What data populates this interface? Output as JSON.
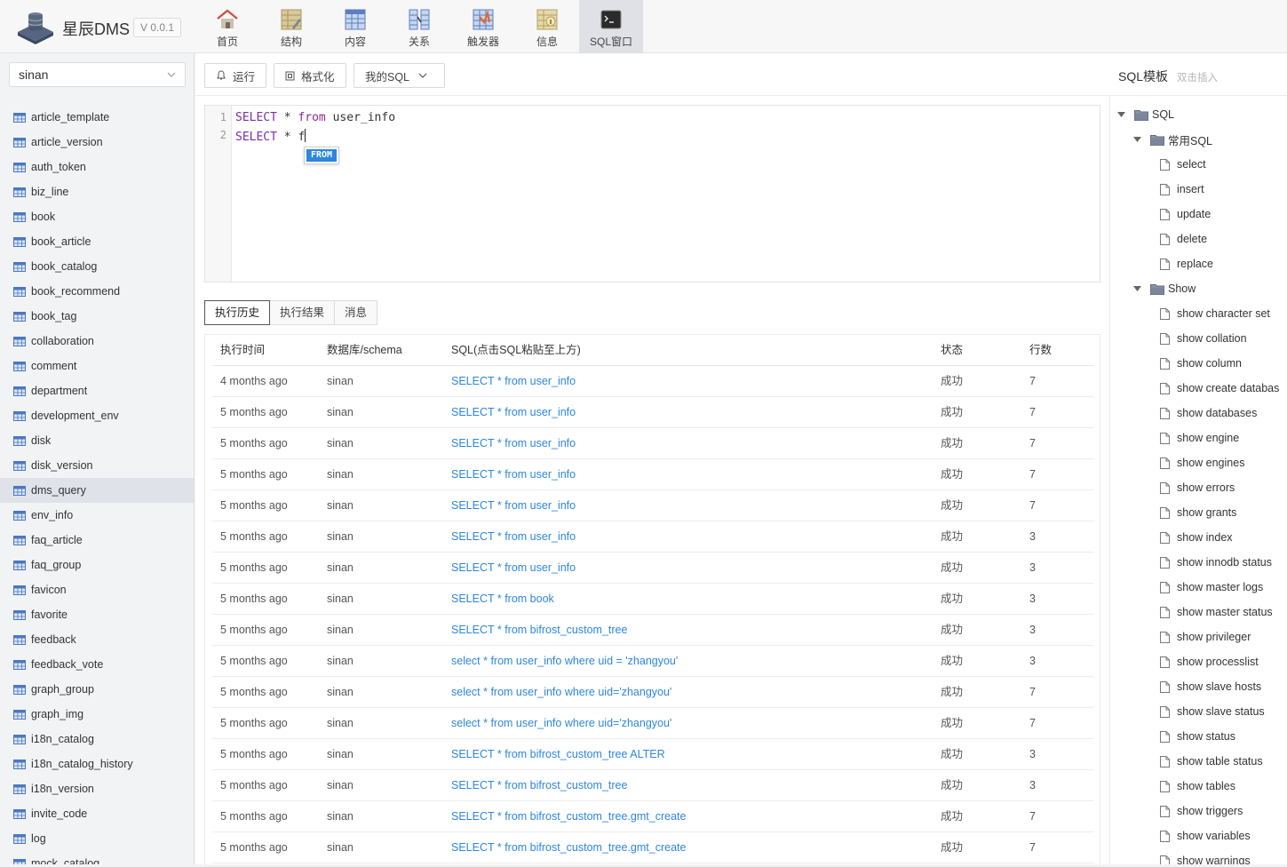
{
  "app": {
    "name": "星辰DMS",
    "version": "V 0.0.1"
  },
  "nav": [
    {
      "label": "首页",
      "icon": "home-icon"
    },
    {
      "label": "结构",
      "icon": "structure-icon"
    },
    {
      "label": "内容",
      "icon": "content-table-icon"
    },
    {
      "label": "关系",
      "icon": "relation-icon"
    },
    {
      "label": "触发器",
      "icon": "trigger-icon"
    },
    {
      "label": "信息",
      "icon": "info-icon"
    },
    {
      "label": "SQL窗口",
      "icon": "terminal-icon",
      "active": true
    }
  ],
  "sidebar": {
    "database": "sinan",
    "active_table": "dms_query",
    "tables": [
      "article_template",
      "article_version",
      "auth_token",
      "biz_line",
      "book",
      "book_article",
      "book_catalog",
      "book_recommend",
      "book_tag",
      "collaboration",
      "comment",
      "department",
      "development_env",
      "disk",
      "disk_version",
      "dms_query",
      "env_info",
      "faq_article",
      "faq_group",
      "favicon",
      "favorite",
      "feedback",
      "feedback_vote",
      "graph_group",
      "graph_img",
      "i18n_catalog",
      "i18n_catalog_history",
      "i18n_version",
      "invite_code",
      "log",
      "mock_catalog"
    ]
  },
  "toolbar": {
    "run": "运行",
    "format": "格式化",
    "my_sql": "我的SQL",
    "template_title": "SQL模板",
    "template_hint": "双击插入"
  },
  "editor": {
    "lines": [
      {
        "no": "1",
        "kw1": "SELECT",
        "op": " * ",
        "kw2": "from",
        "rest": " user_info"
      },
      {
        "no": "2",
        "kw1": "SELECT",
        "op": " * ",
        "kw2": "",
        "rest": "f"
      }
    ],
    "autocomplete": "FROM"
  },
  "tabs": [
    "执行历史",
    "执行结果",
    "消息"
  ],
  "history": {
    "headers": [
      "执行时间",
      "数据库/schema",
      "SQL(点击SQL粘贴至上方)",
      "状态",
      "行数"
    ],
    "rows": [
      [
        "4 months ago",
        "sinan",
        "SELECT * from user_info",
        "成功",
        "7"
      ],
      [
        "5 months ago",
        "sinan",
        "SELECT * from user_info",
        "成功",
        "7"
      ],
      [
        "5 months ago",
        "sinan",
        "SELECT * from user_info",
        "成功",
        "7"
      ],
      [
        "5 months ago",
        "sinan",
        "SELECT * from user_info",
        "成功",
        "7"
      ],
      [
        "5 months ago",
        "sinan",
        "SELECT * from user_info",
        "成功",
        "7"
      ],
      [
        "5 months ago",
        "sinan",
        "SELECT * from user_info",
        "成功",
        "3"
      ],
      [
        "5 months ago",
        "sinan",
        "SELECT * from user_info",
        "成功",
        "3"
      ],
      [
        "5 months ago",
        "sinan",
        "SELECT * from book",
        "成功",
        "3"
      ],
      [
        "5 months ago",
        "sinan",
        "SELECT * from bifrost_custom_tree",
        "成功",
        "3"
      ],
      [
        "5 months ago",
        "sinan",
        "select * from user_info where uid = 'zhangyou'",
        "成功",
        "3"
      ],
      [
        "5 months ago",
        "sinan",
        "select * from user_info where uid='zhangyou'",
        "成功",
        "7"
      ],
      [
        "5 months ago",
        "sinan",
        "select * from user_info where uid='zhangyou'",
        "成功",
        "7"
      ],
      [
        "5 months ago",
        "sinan",
        "SELECT * from bifrost_custom_tree ALTER",
        "成功",
        "3"
      ],
      [
        "5 months ago",
        "sinan",
        "SELECT * from bifrost_custom_tree",
        "成功",
        "3"
      ],
      [
        "5 months ago",
        "sinan",
        "SELECT * from bifrost_custom_tree.gmt_create",
        "成功",
        "7"
      ],
      [
        "5 months ago",
        "sinan",
        "SELECT * from bifrost_custom_tree.gmt_create",
        "成功",
        "7"
      ]
    ]
  },
  "tree": {
    "root": "SQL",
    "groups": [
      {
        "label": "常用SQL",
        "items": [
          "select",
          "insert",
          "update",
          "delete",
          "replace"
        ]
      },
      {
        "label": "Show",
        "items": [
          "show character set",
          "show collation",
          "show column",
          "show create databas",
          "show databases",
          "show engine",
          "show engines",
          "show errors",
          "show grants",
          "show index",
          "show innodb status",
          "show master logs",
          "show master status",
          "show privileger",
          "show processlist",
          "show slave hosts",
          "show slave status",
          "show status",
          "show table status",
          "show tables",
          "show triggers",
          "show variables",
          "show warnings"
        ]
      }
    ]
  },
  "colors": {
    "link": "#2e86de",
    "keyword": "#7a2fa6",
    "active_nav": "#dfe1e6"
  }
}
